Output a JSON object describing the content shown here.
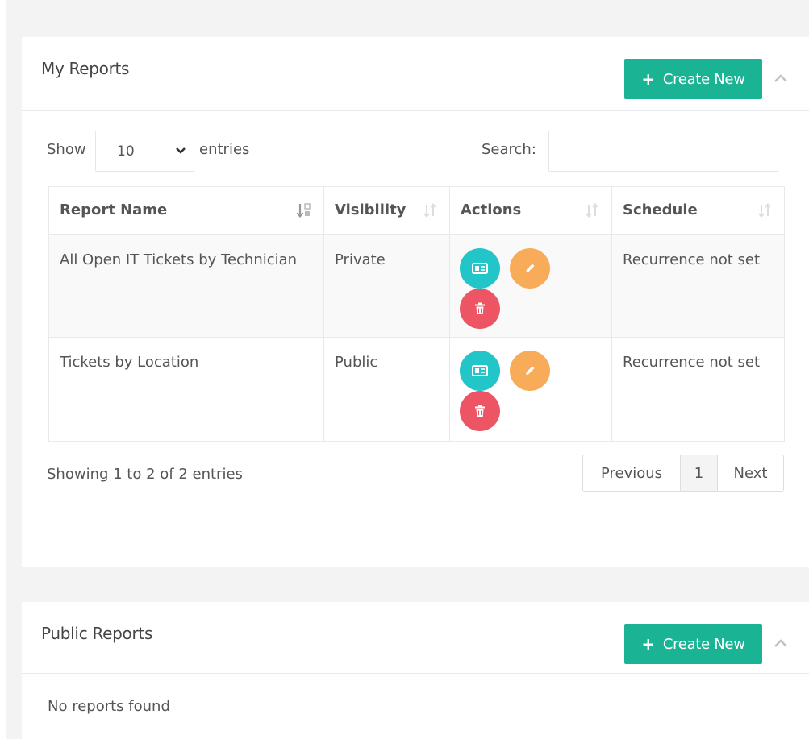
{
  "my_reports": {
    "title": "My Reports",
    "create_label": "Create New",
    "length": {
      "show": "Show",
      "value": "10",
      "entries": "entries"
    },
    "search_label": "Search:",
    "search_value": "",
    "columns": [
      "Report Name",
      "Visibility",
      "Actions",
      "Schedule"
    ],
    "rows": [
      {
        "name": "All Open IT Tickets by Technician",
        "visibility": "Private",
        "schedule": "Recurrence not set"
      },
      {
        "name": "Tickets by Location",
        "visibility": "Public",
        "schedule": "Recurrence not set"
      }
    ],
    "info": "Showing 1 to 2 of 2 entries",
    "pager": {
      "previous": "Previous",
      "page": "1",
      "next": "Next"
    }
  },
  "public_reports": {
    "title": "Public Reports",
    "create_label": "Create New",
    "empty_text": "No reports found"
  },
  "colors": {
    "create": "#1ab394",
    "view": "#23c6c8",
    "edit": "#f8ac59",
    "delete": "#ed5565"
  },
  "icons": {
    "create": "plus-icon",
    "collapse": "chevron-up-icon",
    "select": "chevron-down-icon",
    "sort_active": "sort-alpha-down-icon",
    "sort": "sort-icon",
    "view": "id-card-icon",
    "edit": "pencil-icon",
    "delete": "trash-icon"
  }
}
